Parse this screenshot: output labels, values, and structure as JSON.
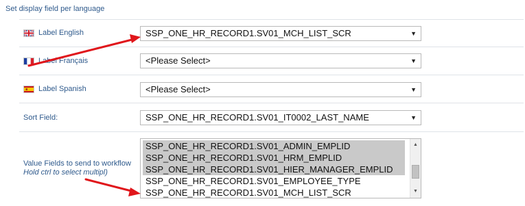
{
  "section_title": "Set display field per language",
  "fields": {
    "label_english": {
      "label": "Label English",
      "flag_icon": "uk-flag-icon",
      "value": "SSP_ONE_HR_RECORD1.SV01_MCH_LIST_SCR"
    },
    "label_francais": {
      "label": "Label Français",
      "flag_icon": "france-flag-icon",
      "value": "<Please Select>"
    },
    "label_spanish": {
      "label": "Label Spanish",
      "flag_icon": "spain-flag-icon",
      "value": "<Please Select>"
    },
    "sort_field": {
      "label": "Sort Field:",
      "value": "SSP_ONE_HR_RECORD1.SV01_IT0002_LAST_NAME"
    }
  },
  "value_fields": {
    "label": "Value Fields to send to workflow",
    "hint": "Hold ctrl to select multipl)",
    "options": [
      {
        "text": "SSP_ONE_HR_RECORD1.SV01_ADMIN_EMPLID",
        "selected": true
      },
      {
        "text": "SSP_ONE_HR_RECORD1.SV01_HRM_EMPLID",
        "selected": true
      },
      {
        "text": "SSP_ONE_HR_RECORD1.SV01_HIER_MANAGER_EMPLID",
        "selected": true
      },
      {
        "text": "SSP_ONE_HR_RECORD1.SV01_EMPLOYEE_TYPE",
        "selected": false
      },
      {
        "text": "SSP_ONE_HR_RECORD1.SV01_MCH_LIST_SCR",
        "selected": false
      }
    ]
  },
  "colors": {
    "label_text": "#2f5a8c",
    "selected_option_bg": "#c9c9c9",
    "annotation_arrow": "#e0161b",
    "row_divider": "#dfe3e8"
  },
  "icons": {
    "dropdown": "caret-down-icon",
    "scroll_up": "scroll-up-arrow-icon",
    "scroll_down": "scroll-down-arrow-icon",
    "annotation": "red-arrow-icon"
  }
}
